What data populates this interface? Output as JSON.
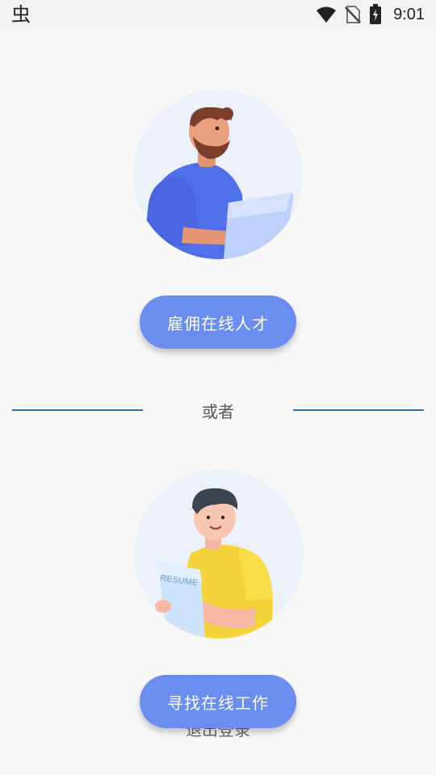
{
  "status_bar": {
    "left_icon": "app-notification-icon",
    "left_glyph": "虫",
    "wifi_icon": "wifi-icon",
    "no_sim_icon": "no-sim-icon",
    "battery_icon": "battery-charging-icon",
    "time": "9:01"
  },
  "hire": {
    "illustration": "man-with-laptop-illustration",
    "button_label": "雇佣在线人才"
  },
  "divider": {
    "text": "或者"
  },
  "find": {
    "illustration": "man-with-resume-illustration",
    "resume_text": "RESUME",
    "button_label": "寻找在线工作"
  },
  "logout": {
    "label": "退出登录"
  },
  "colors": {
    "button": "#6a8df0",
    "divider": "#2f72b8",
    "circle": "#edf1fb",
    "background": "#f8f8f8"
  }
}
